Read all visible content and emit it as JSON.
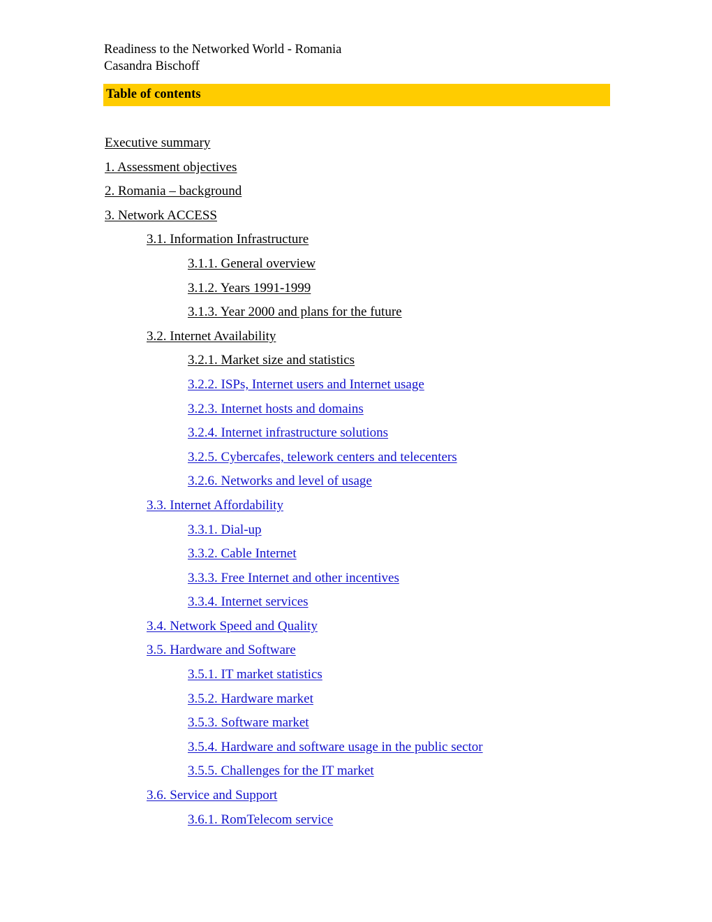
{
  "document": {
    "header_line_1": "Readiness to the Networked World - Romania",
    "header_line_2": "Casandra Bischoff"
  },
  "toc": {
    "bar_label": "Table of contents",
    "bar_color": "#ffcc00",
    "visited_link_color": "#000000",
    "link_color": "#1212cc",
    "entries": [
      {
        "label": "Executive summary",
        "level": 0,
        "state": "visited"
      },
      {
        "label": "1. Assessment objectives",
        "level": 0,
        "state": "visited"
      },
      {
        "label": "2. Romania – background",
        "level": 0,
        "state": "visited"
      },
      {
        "label": "3. Network ACCESS",
        "level": 0,
        "state": "visited"
      },
      {
        "label": "3.1. Information Infrastructure",
        "level": 1,
        "state": "visited"
      },
      {
        "label": "3.1.1. General overview",
        "level": 2,
        "state": "visited"
      },
      {
        "label": "3.1.2. Years 1991-1999",
        "level": 2,
        "state": "visited"
      },
      {
        "label": "3.1.3. Year 2000 and plans for the future",
        "level": 2,
        "state": "visited"
      },
      {
        "label": "3.2. Internet Availability",
        "level": 1,
        "state": "visited"
      },
      {
        "label": "3.2.1. Market size and statistics",
        "level": 2,
        "state": "visited"
      },
      {
        "label": "3.2.2. ISPs, Internet users and Internet usage",
        "level": 2,
        "state": "link"
      },
      {
        "label": "3.2.3. Internet hosts and domains",
        "level": 2,
        "state": "link"
      },
      {
        "label": "3.2.4. Internet infrastructure solutions",
        "level": 2,
        "state": "link"
      },
      {
        "label": "3.2.5. Cybercafes, telework centers and telecenters",
        "level": 2,
        "state": "link"
      },
      {
        "label": "3.2.6. Networks and level of usage",
        "level": 2,
        "state": "link"
      },
      {
        "label": "3.3. Internet Affordability",
        "level": 1,
        "state": "link"
      },
      {
        "label": "3.3.1. Dial-up",
        "level": 2,
        "state": "link"
      },
      {
        "label": "3.3.2. Cable Internet",
        "level": 2,
        "state": "link"
      },
      {
        "label": "3.3.3. Free Internet and other incentives",
        "level": 2,
        "state": "link"
      },
      {
        "label": "3.3.4. Internet services",
        "level": 2,
        "state": "link"
      },
      {
        "label": "3.4. Network Speed and Quality",
        "level": 1,
        "state": "link"
      },
      {
        "label": "3.5. Hardware and Software",
        "level": 1,
        "state": "link"
      },
      {
        "label": "3.5.1. IT market statistics",
        "level": 2,
        "state": "link"
      },
      {
        "label": "3.5.2. Hardware market",
        "level": 2,
        "state": "link"
      },
      {
        "label": "3.5.3. Software market",
        "level": 2,
        "state": "link"
      },
      {
        "label": "3.5.4. Hardware and software usage in the public sector",
        "level": 2,
        "state": "link"
      },
      {
        "label": "3.5.5. Challenges for the IT market",
        "level": 2,
        "state": "link"
      },
      {
        "label": "3.6. Service and Support",
        "level": 1,
        "state": "link"
      },
      {
        "label": "3.6.1. RomTelecom service",
        "level": 2,
        "state": "link"
      }
    ]
  }
}
